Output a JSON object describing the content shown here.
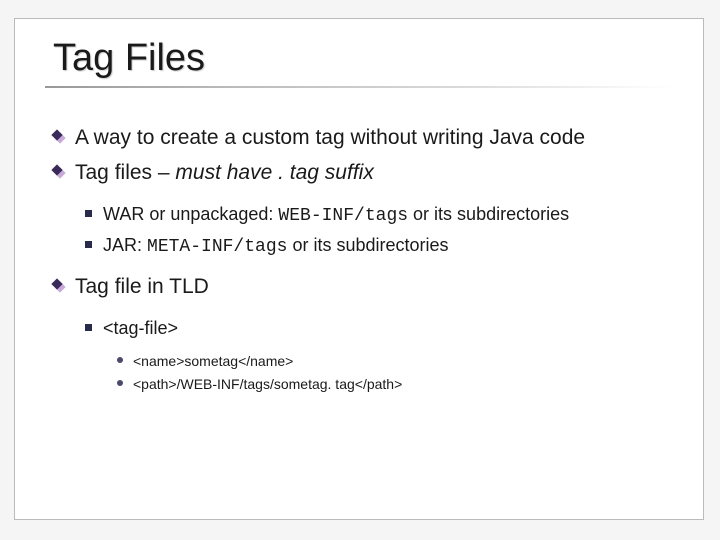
{
  "title": "Tag Files",
  "bullets": {
    "b1": "A way to create a custom tag without writing Java code",
    "b2_pre": "Tag files – ",
    "b2_em": "must have . tag suffix",
    "b2a_pre": "WAR or unpackaged: ",
    "b2a_code": "WEB-INF/tags",
    "b2a_post": " or its subdirectories",
    "b2b_pre": "JAR: ",
    "b2b_code": "META-INF/tags",
    "b2b_post": " or its subdirectories",
    "b3": "Tag file in TLD",
    "b3a": "<tag-file>",
    "b3a1": "<name>sometag</name>",
    "b3a2": "<path>/WEB-INF/tags/sometag. tag</path>"
  }
}
